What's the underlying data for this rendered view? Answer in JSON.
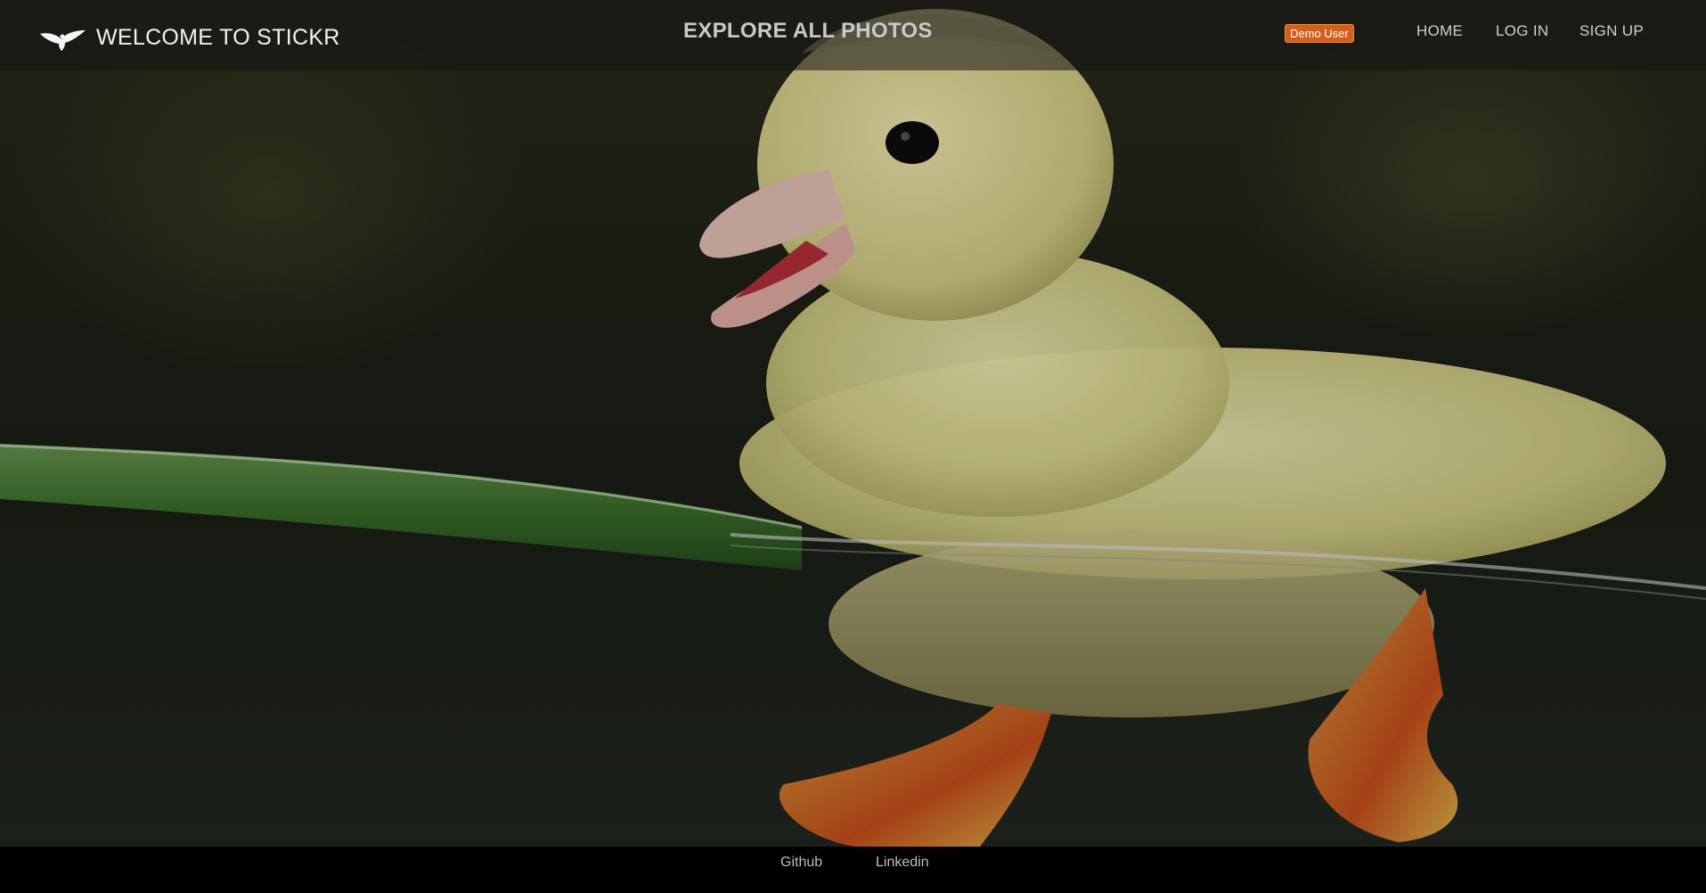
{
  "header": {
    "brand_title": "WELCOME TO STICKR",
    "brand_icon": "bird-logo-icon",
    "explore_label": "EXPLORE ALL PHOTOS",
    "demo_user_label": "Demo User",
    "nav": {
      "home": "HOME",
      "login": "LOG IN",
      "signup": "SIGN UP"
    }
  },
  "hero": {
    "image": "duckling-swimming-photo"
  },
  "footer": {
    "github": "Github",
    "linkedin": "Linkedin"
  },
  "colors": {
    "demo_badge": "#d35f1a",
    "footer_bg": "#000000",
    "nav_text": "#cfcfcf"
  }
}
